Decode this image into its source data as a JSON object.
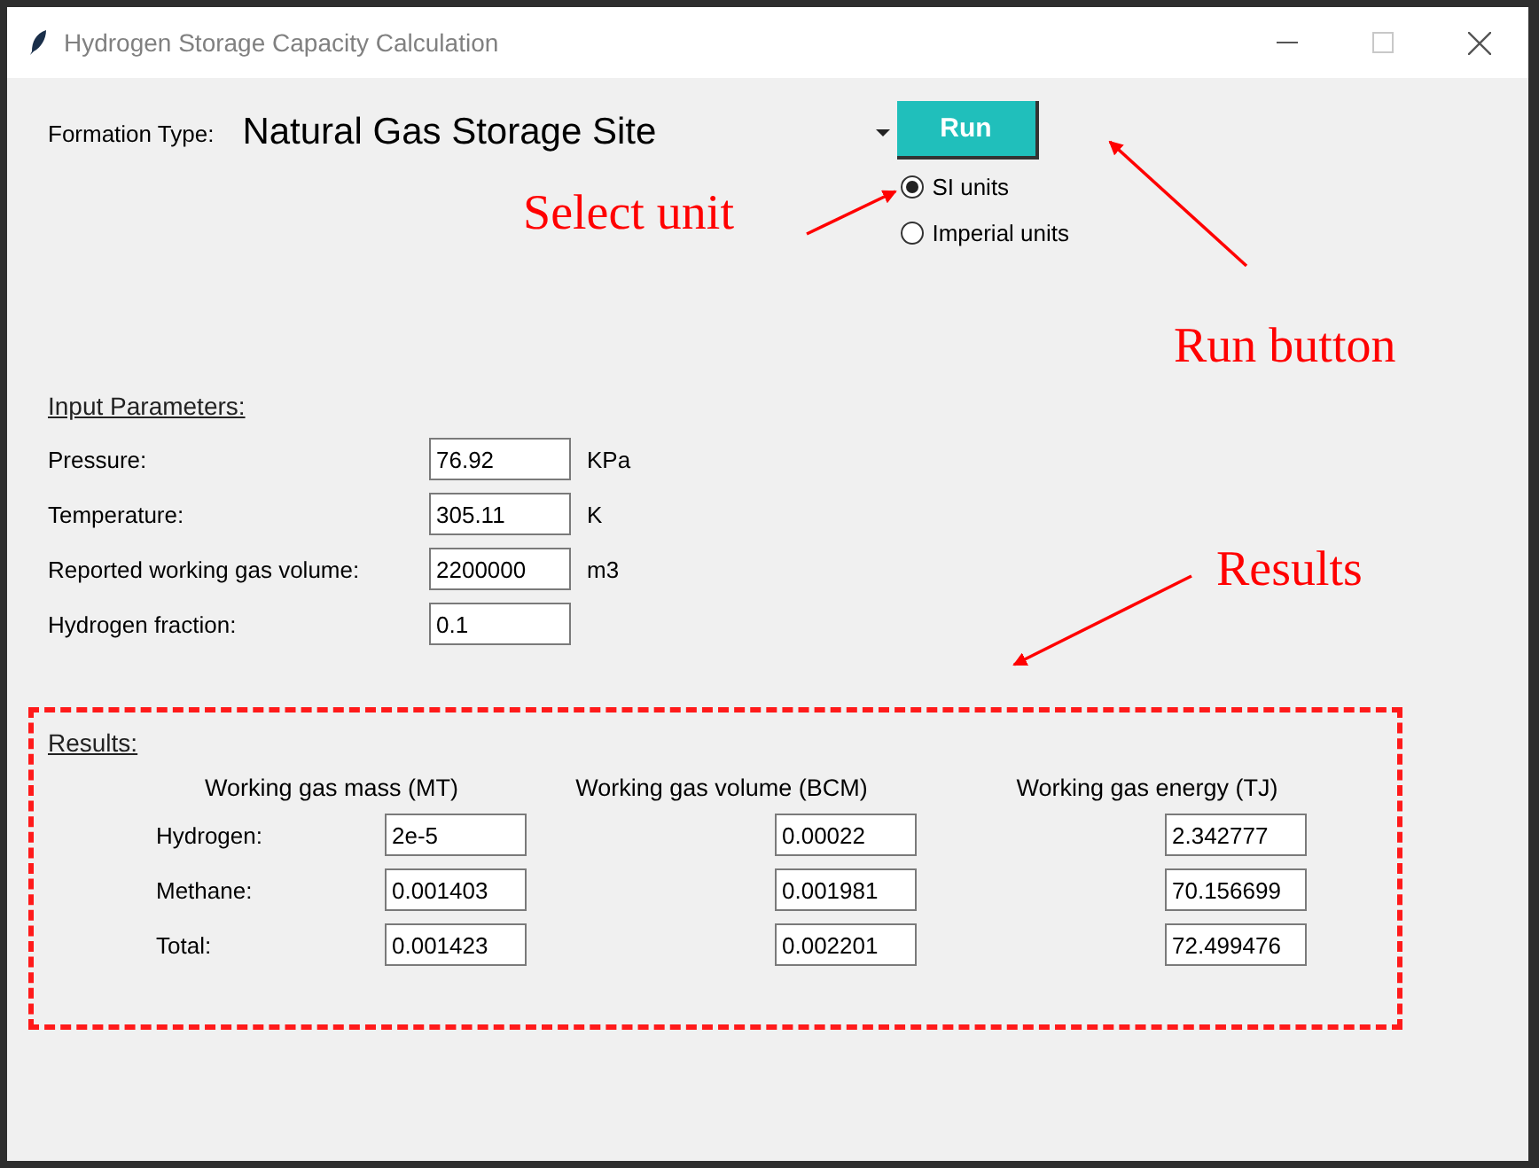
{
  "window": {
    "title": "Hydrogen Storage Capacity Calculation"
  },
  "formation": {
    "label": "Formation Type:",
    "value": "Natural Gas Storage Site"
  },
  "run_button": "Run",
  "units": [
    {
      "label": "SI units",
      "selected": true
    },
    {
      "label": "Imperial units",
      "selected": false
    }
  ],
  "input_parameters": {
    "heading": "Input Parameters:",
    "rows": [
      {
        "label": "Pressure:",
        "value": "76.92",
        "unit": "KPa"
      },
      {
        "label": "Temperature:",
        "value": "305.11",
        "unit": "K"
      },
      {
        "label": "Reported working gas volume:",
        "value": "2200000",
        "unit": "m3"
      },
      {
        "label": "Hydrogen fraction:",
        "value": "0.1"
      }
    ]
  },
  "results": {
    "heading": "Results:",
    "columns": [
      "Working gas mass (MT)",
      "Working gas volume (BCM)",
      "Working gas energy (TJ)"
    ],
    "rows": [
      {
        "label": "Hydrogen:",
        "values": [
          "2e-5",
          "0.00022",
          "2.342777"
        ]
      },
      {
        "label": "Methane:",
        "values": [
          "0.001403",
          "0.001981",
          "70.156699"
        ]
      },
      {
        "label": "Total:",
        "values": [
          "0.001423",
          "0.002201",
          "72.499476"
        ]
      }
    ]
  },
  "annotations": [
    {
      "text": "Select unit"
    },
    {
      "text": "Run button"
    },
    {
      "text": "Results"
    }
  ]
}
